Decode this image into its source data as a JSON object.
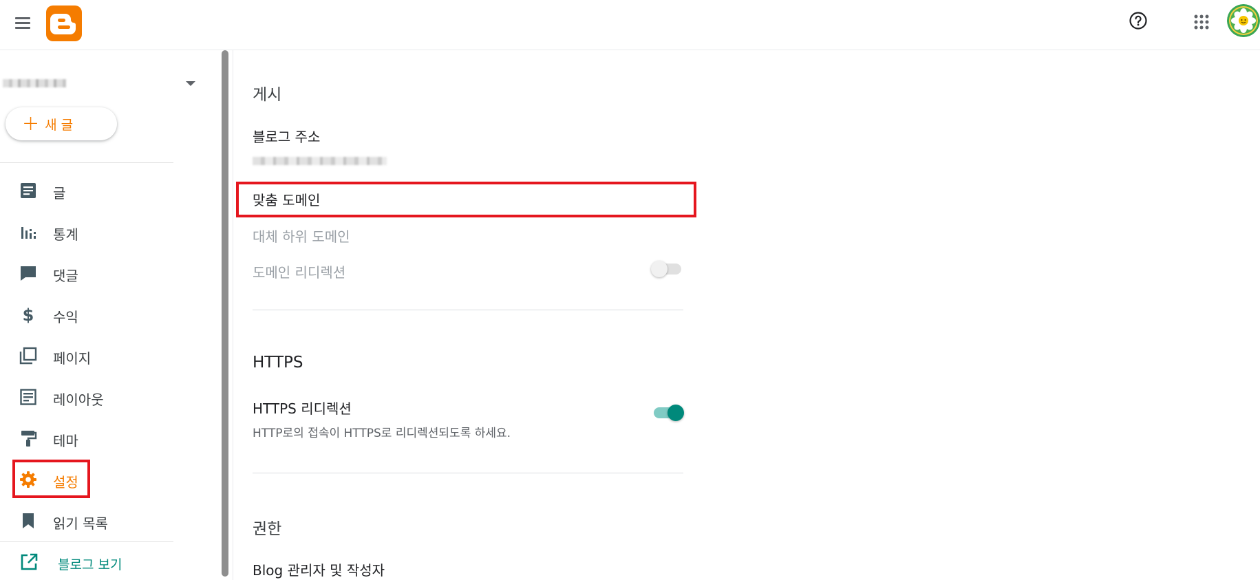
{
  "app": {
    "name": "Blogger"
  },
  "header": {
    "menu_icon": "hamburger-menu-icon",
    "logo_icon": "blogger-logo",
    "help_icon": "help-circle-icon",
    "apps_icon": "apps-grid-icon",
    "avatar_icon": "flower-avatar"
  },
  "sidebar": {
    "new_post_label": "새 글",
    "items": [
      {
        "label": "글",
        "icon": "posts-icon"
      },
      {
        "label": "통계",
        "icon": "stats-icon"
      },
      {
        "label": "댓글",
        "icon": "comments-icon"
      },
      {
        "label": "수익",
        "icon": "dollar-icon"
      },
      {
        "label": "페이지",
        "icon": "pages-icon"
      },
      {
        "label": "레이아웃",
        "icon": "layout-icon"
      },
      {
        "label": "테마",
        "icon": "paint-roller-icon"
      },
      {
        "label": "설정",
        "icon": "gear-icon",
        "active": true
      },
      {
        "label": "읽기 목록",
        "icon": "bookmark-icon"
      }
    ],
    "view_blog_label": "블로그 보기"
  },
  "main": {
    "section_publishing": "게시",
    "blog_address_label": "블로그 주소",
    "custom_domain_label": "맞춤 도메인",
    "fallback_subdomain_label": "대체 하위 도메인",
    "domain_redirect_label": "도메인 리디렉션",
    "domain_redirect_enabled": false,
    "section_https": "HTTPS",
    "https_redirect_label": "HTTPS 리디렉션",
    "https_redirect_desc": "HTTP로의 접속이 HTTPS로 리디렉션되도록 하세요.",
    "https_redirect_enabled": true,
    "section_permissions": "권한",
    "blog_admins_label": "Blog 관리자 및 작성자"
  },
  "colors": {
    "accent": "#f57c00",
    "teal": "#00897b",
    "highlight": "#e5161e"
  }
}
